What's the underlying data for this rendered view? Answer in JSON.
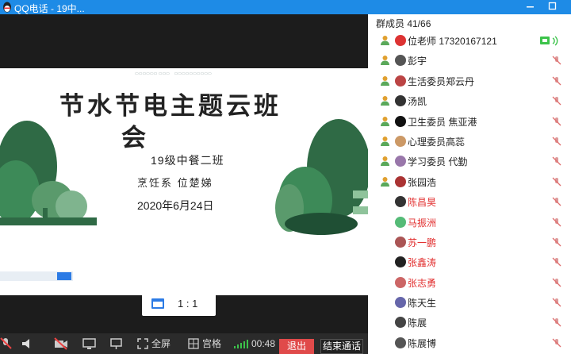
{
  "window": {
    "title": "QQ电话 - 19中..."
  },
  "ratio_control": {
    "label": "1 : 1"
  },
  "slide": {
    "title_line1": "节水节电主题云班",
    "title_line2": "会",
    "class_name": "19级中餐二班",
    "teacher": "烹饪系 位楚娣",
    "date": "2020年6月24日"
  },
  "toolbar": {
    "fullscreen_label": "全屏",
    "grid_label": "宫格",
    "duration": "00:48",
    "exit_label": "退出",
    "end_call_label": "结束通话"
  },
  "members_panel": {
    "header": "群成员 41/66",
    "members": [
      {
        "name": "位老师 17320167121",
        "role": "admin",
        "name_color": "#222222",
        "avatar_color": "#d33",
        "audio": "speaking"
      },
      {
        "name": "彭宇",
        "role": "admin",
        "name_color": "#222222",
        "avatar_color": "#555",
        "audio": "muted"
      },
      {
        "name": "生活委员郑云丹",
        "role": "admin",
        "name_color": "#222222",
        "avatar_color": "#b44",
        "audio": "muted"
      },
      {
        "name": "汤凯",
        "role": "admin",
        "name_color": "#222222",
        "avatar_color": "#333",
        "audio": "muted"
      },
      {
        "name": "卫生委员   焦亚港",
        "role": "admin",
        "name_color": "#222222",
        "avatar_color": "#111",
        "audio": "muted"
      },
      {
        "name": "心理委员高蕊",
        "role": "admin",
        "name_color": "#222222",
        "avatar_color": "#c96",
        "audio": "muted"
      },
      {
        "name": "学习委员  代勤",
        "role": "admin",
        "name_color": "#222222",
        "avatar_color": "#97a",
        "audio": "muted"
      },
      {
        "name": "张园浩",
        "role": "admin",
        "name_color": "#222222",
        "avatar_color": "#a33",
        "audio": "muted"
      },
      {
        "name": "陈昌昊",
        "role": "none",
        "name_color": "#e23030",
        "avatar_color": "#333",
        "audio": "muted"
      },
      {
        "name": "马振洲",
        "role": "none",
        "name_color": "#e23030",
        "avatar_color": "#5b7",
        "audio": "muted"
      },
      {
        "name": "苏一鹏",
        "role": "none",
        "name_color": "#e23030",
        "avatar_color": "#a55",
        "audio": "muted"
      },
      {
        "name": "张鑫涛",
        "role": "none",
        "name_color": "#e23030",
        "avatar_color": "#222",
        "audio": "muted"
      },
      {
        "name": "张志勇",
        "role": "none",
        "name_color": "#e23030",
        "avatar_color": "#c66",
        "audio": "muted"
      },
      {
        "name": "陈天生",
        "role": "none",
        "name_color": "#222222",
        "avatar_color": "#66a",
        "audio": "muted"
      },
      {
        "name": "陈展",
        "role": "none",
        "name_color": "#222222",
        "avatar_color": "#444",
        "audio": "muted"
      },
      {
        "name": "陈展博",
        "role": "none",
        "name_color": "#222222",
        "avatar_color": "#555",
        "audio": "muted"
      }
    ]
  },
  "colors": {
    "accent": "#1e8be6",
    "exit": "#e04a4a",
    "signal": "#3cc34a"
  }
}
